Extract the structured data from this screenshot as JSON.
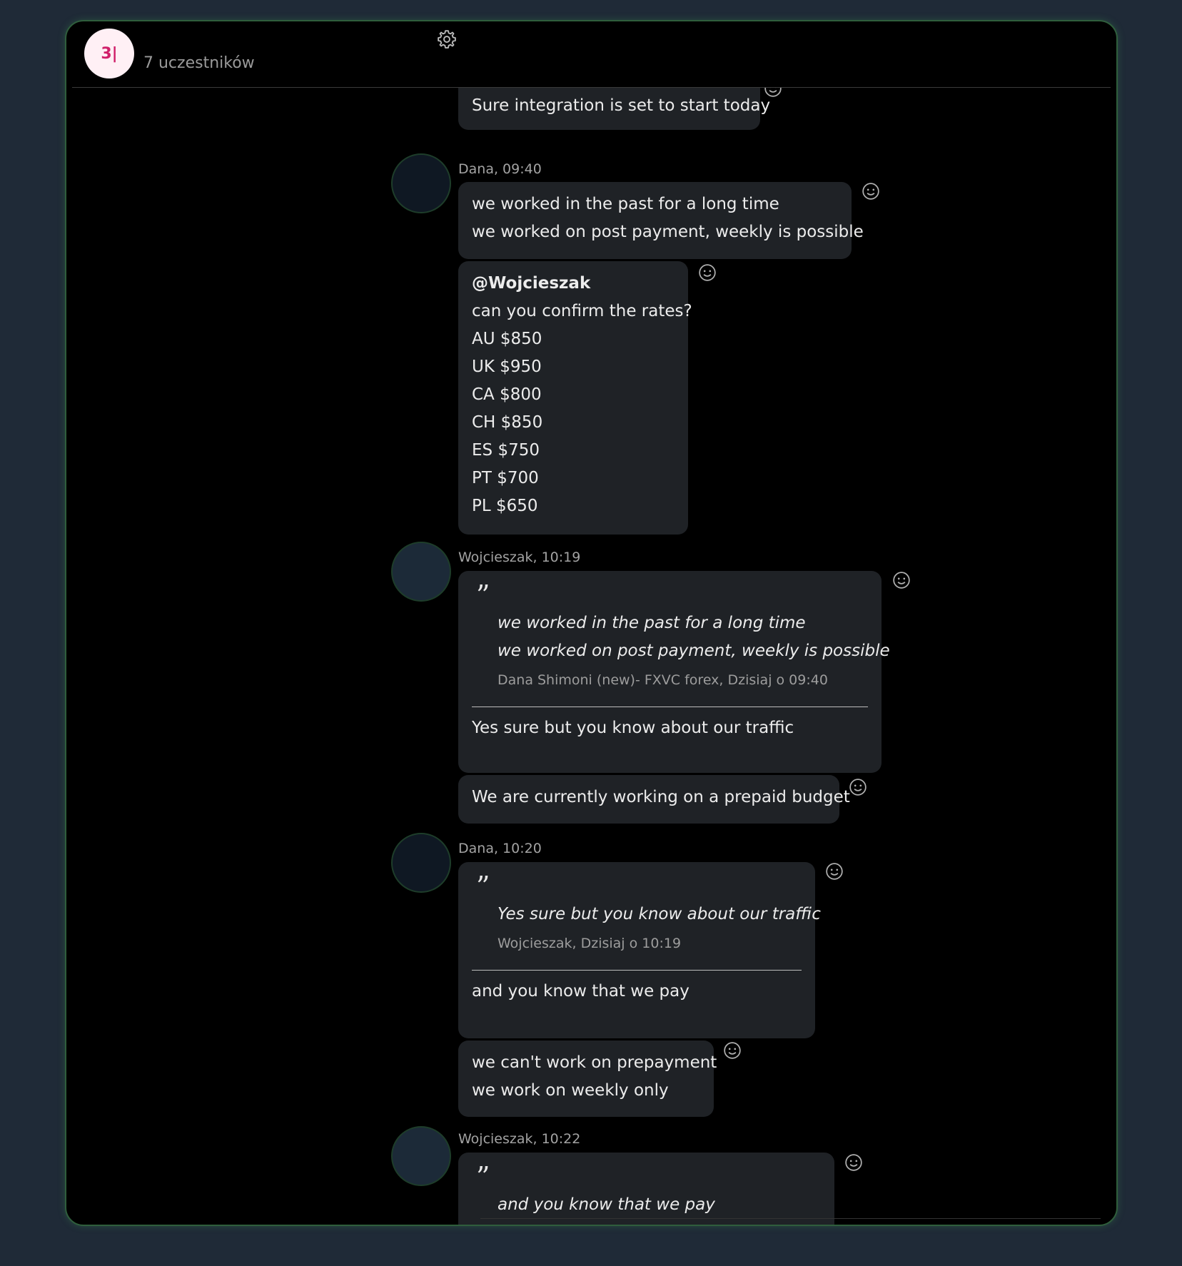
{
  "header": {
    "logo_text": "3|",
    "participants": "7 uczestników"
  },
  "messages": [
    {
      "text": "Sure integration is set to start today"
    },
    {
      "meta": "Dana, 09:40",
      "lines": [
        "we worked in the past for a long time",
        "we worked on post payment, weekly is possible"
      ]
    },
    {
      "mention": "@Wojcieszak",
      "lines": [
        "can you confirm the rates?",
        "AU $850",
        "UK $950",
        "CA $800",
        "CH $850",
        "ES $750",
        "PT $700",
        "PL $650"
      ]
    },
    {
      "meta": "Wojcieszak, 10:19",
      "quote_mark": "99",
      "quote_lines": [
        "we worked in the past for a long time",
        "we worked on post payment, weekly is possible"
      ],
      "quote_source": "Dana Shimoni (new)- FXVC forex, Dzisiaj o 09:40",
      "text": "Yes sure but you know about our traffic"
    },
    {
      "text": "We are currently working on a prepaid budget"
    },
    {
      "meta": "Dana, 10:20",
      "quote_mark": "99",
      "quote_lines": [
        "Yes sure but you know about our traffic"
      ],
      "quote_source": "Wojcieszak, Dzisiaj o 10:19",
      "text": "and you know that we pay"
    },
    {
      "lines": [
        "we can't work on prepayment",
        "we work on weekly only"
      ]
    },
    {
      "meta": "Wojcieszak, 10:22",
      "quote_mark": "99",
      "quote_lines": [
        "and you know that we pay"
      ]
    }
  ],
  "colors": {
    "page_background": "#1f2a37",
    "window_background": "#000000",
    "bubble": "#1f2226",
    "window_border": "#2f5e3c",
    "logo_accent": "#d0206a"
  },
  "icons": {
    "settings": "gear-icon",
    "reaction": "smiley-icon"
  }
}
